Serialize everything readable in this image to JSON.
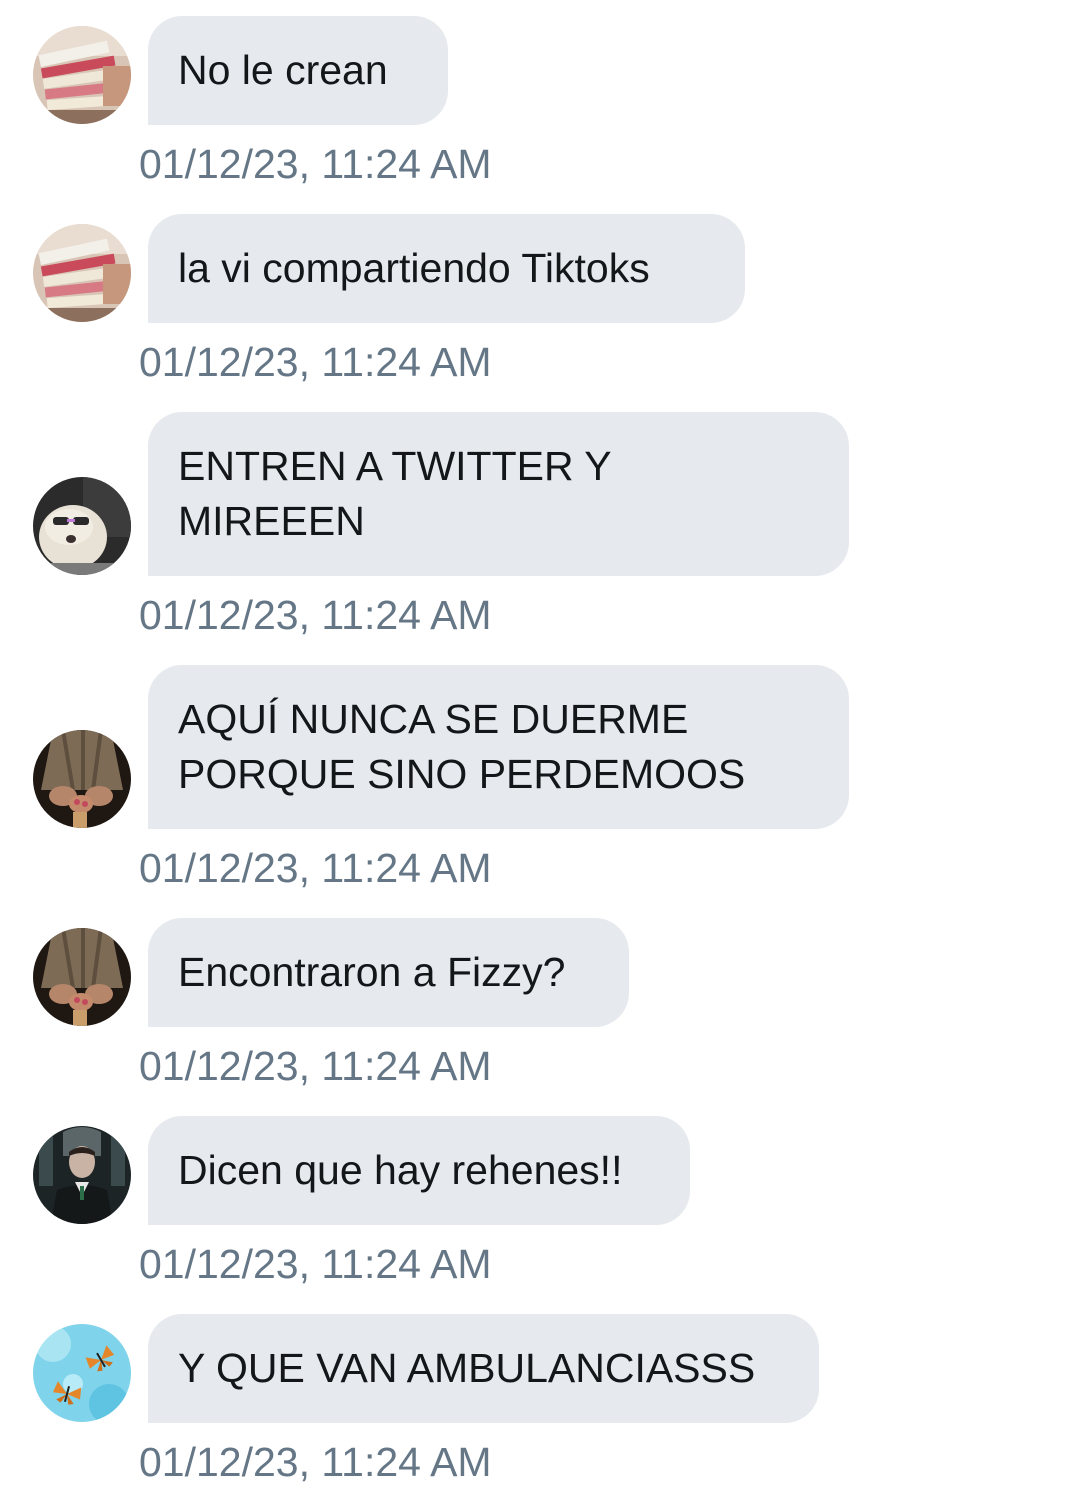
{
  "messages": [
    {
      "avatar": "avatar-books",
      "text": "No le crean",
      "time": "01/12/23, 11:24 AM"
    },
    {
      "avatar": "avatar-books",
      "text": "la vi compartiendo Tiktoks",
      "time": "01/12/23, 11:24 AM"
    },
    {
      "avatar": "avatar-dog-sunglasses",
      "text": "ENTREN A TWITTER Y\nMIREEEN",
      "time": "01/12/23, 11:24 AM"
    },
    {
      "avatar": "avatar-hands-dress",
      "text": "AQUÍ NUNCA SE DUERME\nPORQUE SINO PERDEMOOS",
      "time": "01/12/23, 11:24 AM"
    },
    {
      "avatar": "avatar-hands-dress",
      "text": "Encontraron a Fizzy?",
      "time": "01/12/23, 11:24 AM"
    },
    {
      "avatar": "avatar-boy-uniform",
      "text": "Dicen que hay rehenes!!",
      "time": "01/12/23, 11:24 AM"
    },
    {
      "avatar": "avatar-butterflies",
      "text": "Y QUE VAN AMBULANCIASSS",
      "time": "01/12/23, 11:24 AM"
    }
  ],
  "colors": {
    "bubble_bg": "#e6e9ee",
    "text": "#14171a",
    "timestamp": "#657786"
  }
}
